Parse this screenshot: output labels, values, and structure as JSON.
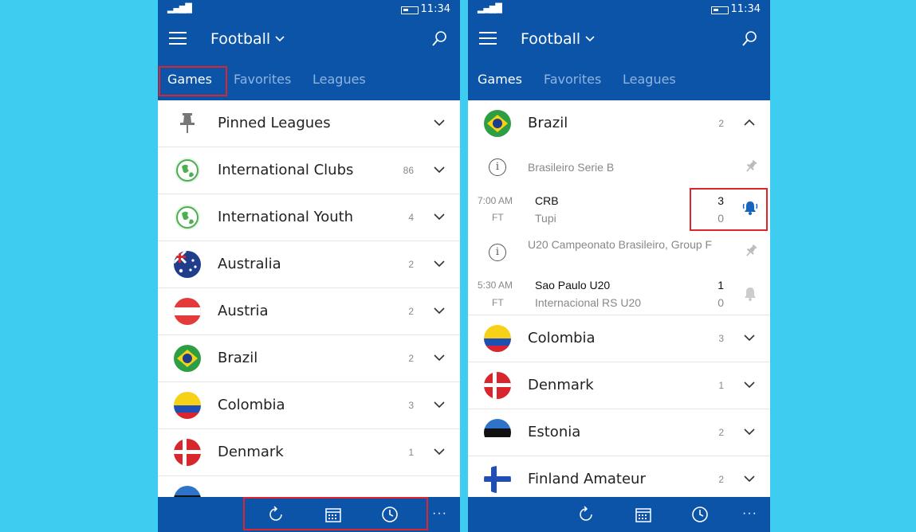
{
  "status": {
    "time": "11:34"
  },
  "header": {
    "title": "Football"
  },
  "tabs": [
    "Games",
    "Favorites",
    "Leagues"
  ],
  "left_list": [
    {
      "label": "Pinned Leagues",
      "count": "",
      "icon": "pin-icon"
    },
    {
      "label": "International Clubs",
      "count": "86",
      "icon": "globe-icon"
    },
    {
      "label": "International Youth",
      "count": "4",
      "icon": "globe-icon"
    },
    {
      "label": "Australia",
      "count": "2",
      "icon": "flag-australia-icon"
    },
    {
      "label": "Austria",
      "count": "2",
      "icon": "flag-austria-icon"
    },
    {
      "label": "Brazil",
      "count": "2",
      "icon": "flag-brazil-icon"
    },
    {
      "label": "Colombia",
      "count": "3",
      "icon": "flag-colombia-icon"
    },
    {
      "label": "Denmark",
      "count": "1",
      "icon": "flag-denmark-icon"
    }
  ],
  "right_panel": {
    "brazil": {
      "label": "Brazil",
      "count": "2"
    },
    "competitions": [
      {
        "name": "Brasileiro Serie B",
        "match": {
          "time": "7:00 AM",
          "status": "FT",
          "home": "CRB",
          "away": "Tupi",
          "home_score": "3",
          "away_score": "0"
        }
      },
      {
        "name": "U20 Campeonato Brasileiro, Group F",
        "match": {
          "time": "5:30 AM",
          "status": "FT",
          "home": "Sao Paulo U20",
          "away": "Internacional RS U20",
          "home_score": "1",
          "away_score": "0"
        }
      }
    ],
    "countries": [
      {
        "label": "Colombia",
        "count": "3",
        "icon": "flag-colombia-icon"
      },
      {
        "label": "Denmark",
        "count": "1",
        "icon": "flag-denmark-icon"
      },
      {
        "label": "Estonia",
        "count": "2",
        "icon": "flag-estonia-icon"
      },
      {
        "label": "Finland Amateur",
        "count": "2",
        "icon": "flag-finland-icon"
      }
    ]
  },
  "bottom_bar": {
    "more": "···",
    "icons": [
      "refresh-icon",
      "calendar-icon",
      "clock-icon"
    ]
  },
  "colors": {
    "appbar": "#0b54a8",
    "background": "#3ecdf0",
    "highlight": "#e0242e"
  }
}
